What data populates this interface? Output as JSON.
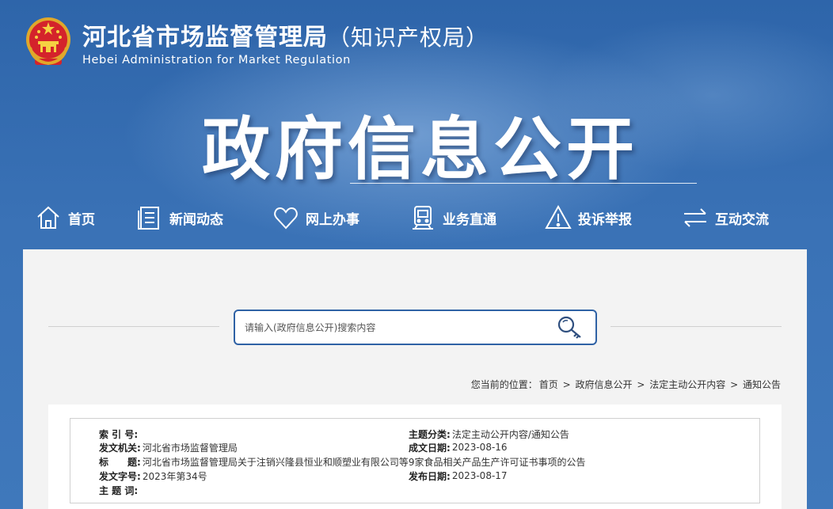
{
  "header": {
    "title_cn": "河北省市场监督管理局",
    "title_sub": "（知识产权局）",
    "title_en": "Hebei Administration for Market Regulation",
    "big_title": "政府信息公开",
    "emblem_icon": "national-emblem-icon"
  },
  "nav": {
    "items": [
      {
        "label": "首页",
        "icon": "home-icon"
      },
      {
        "label": "新闻动态",
        "icon": "news-icon"
      },
      {
        "label": "网上办事",
        "icon": "heart-icon"
      },
      {
        "label": "业务直通",
        "icon": "train-icon"
      },
      {
        "label": "投诉举报",
        "icon": "warning-icon"
      },
      {
        "label": "互动交流",
        "icon": "exchange-icon"
      }
    ]
  },
  "search": {
    "placeholder": "请输入(政府信息公开)搜索内容",
    "icon": "search-key-icon"
  },
  "breadcrumb": {
    "prefix": "您当前的位置：",
    "items": [
      "首页",
      "政府信息公开",
      "法定主动公开内容",
      "通知公告"
    ],
    "separator": ">"
  },
  "info": {
    "index_label": "索 引 号:",
    "index_value": "",
    "topic_label": "主题分类:",
    "topic_value": "法定主动公开内容/通知公告",
    "issuer_label": "发文机关:",
    "issuer_value": "河北省市场监督管理局",
    "date_made_label": "成文日期:",
    "date_made_value": "2023-08-16",
    "title_label": "标　　题:",
    "title_value": "河北省市场监督管理局关于注销兴隆县恒业和顺塑业有限公司等9家食品相关产品生产许可证书事项的公告",
    "doc_no_label": "发文字号:",
    "doc_no_value": "2023年第34号",
    "pub_date_label": "发布日期:",
    "pub_date_value": "2023-08-17",
    "keywords_label": "主 题 词:",
    "keywords_value": ""
  },
  "colors": {
    "banner": "#2f68ad",
    "accent": "#2f62a5",
    "panel": "#f3f3f3"
  }
}
